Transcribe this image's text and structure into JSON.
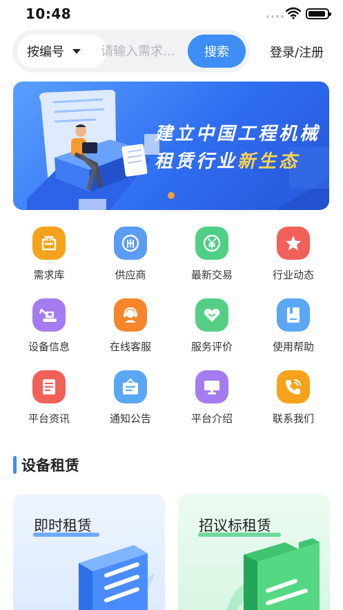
{
  "status": {
    "time": "10:48"
  },
  "search": {
    "type_label": "按编号",
    "placeholder": "请输入需求...",
    "button_label": "搜索"
  },
  "header": {
    "login_label": "登录/注册"
  },
  "banner": {
    "line1": "建立中国工程机械",
    "line2_prefix": "租赁行业",
    "line2_highlight": "新生态"
  },
  "grid": {
    "items": [
      {
        "label": "需求库",
        "icon": "demand-library-icon",
        "color": "#f7a21b"
      },
      {
        "label": "供应商",
        "icon": "supplier-icon",
        "color": "#5b9cf6"
      },
      {
        "label": "最新交易",
        "icon": "yuan-icon",
        "color": "#4fcf86"
      },
      {
        "label": "行业动态",
        "icon": "star-icon",
        "color": "#f2605a"
      },
      {
        "label": "设备信息",
        "icon": "excavator-icon",
        "color": "#a57cf0"
      },
      {
        "label": "在线客服",
        "icon": "headset-icon",
        "color": "#f7862a"
      },
      {
        "label": "服务评价",
        "icon": "heart-icon",
        "color": "#55cf86"
      },
      {
        "label": "使用帮助",
        "icon": "book-icon",
        "color": "#5aa8f5"
      },
      {
        "label": "平台资讯",
        "icon": "news-icon",
        "color": "#f2605a"
      },
      {
        "label": "通知公告",
        "icon": "notice-board-icon",
        "color": "#5aa8f5"
      },
      {
        "label": "平台介绍",
        "icon": "monitor-icon",
        "color": "#a57cf0"
      },
      {
        "label": "联系我们",
        "icon": "phone-icon",
        "color": "#f7a21b"
      }
    ]
  },
  "section": {
    "title": "设备租赁"
  },
  "cards": [
    {
      "title": "即时租赁"
    },
    {
      "title": "招议标租赁"
    }
  ]
}
